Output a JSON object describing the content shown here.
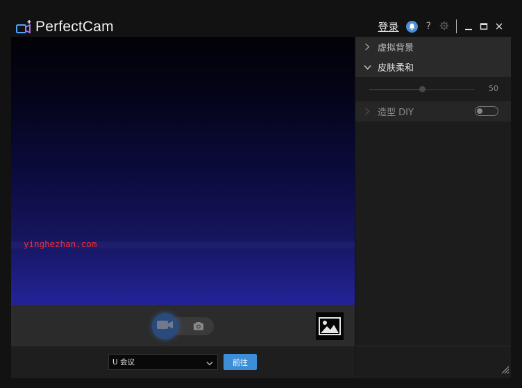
{
  "app": {
    "title": "PerfectCam",
    "login_label": "登录",
    "help_label": "?",
    "brand_color": "#3c8fd6",
    "icons": [
      "perfectcam-logo-icon",
      "bell-icon",
      "gear-icon",
      "minimize-icon",
      "maximize-icon",
      "close-icon"
    ]
  },
  "preview": {
    "watermark": "yinghezhan.com"
  },
  "controls": {
    "video_mode_icon": "video-camera-icon",
    "photo_mode_icon": "camera-icon",
    "gallery_icon": "image-gallery-icon"
  },
  "bottom": {
    "source_select_value": "U 会议",
    "go_button_label": "前往"
  },
  "panel": {
    "virtual_background_label": "虚拟背景",
    "skin_smoothing_label": "皮肤柔和",
    "skin_smoothing_value": "50",
    "skin_smoothing_fraction": 0.5,
    "style_diy_label": "造型 DIY",
    "style_diy_enabled": false
  }
}
